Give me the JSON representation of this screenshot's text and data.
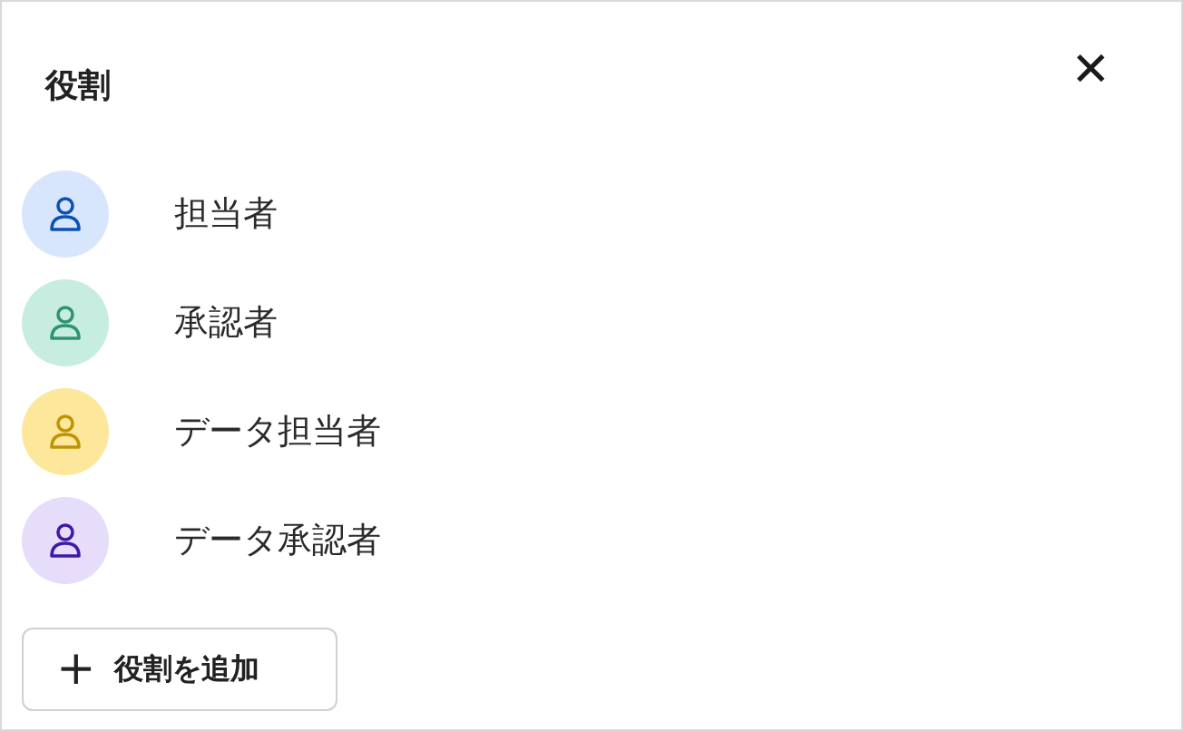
{
  "panel": {
    "title": "役割",
    "close_label": "✕"
  },
  "roles": [
    {
      "name": "担当者",
      "color": "#d7e6fc"
    },
    {
      "name": "承認者",
      "color": "#c7ede0"
    },
    {
      "name": "データ担当者",
      "color": "#fde79b"
    },
    {
      "name": "データ承認者",
      "color": "#e5ddfa"
    }
  ],
  "add_button": {
    "icon": "+",
    "label": "役割を追加"
  }
}
